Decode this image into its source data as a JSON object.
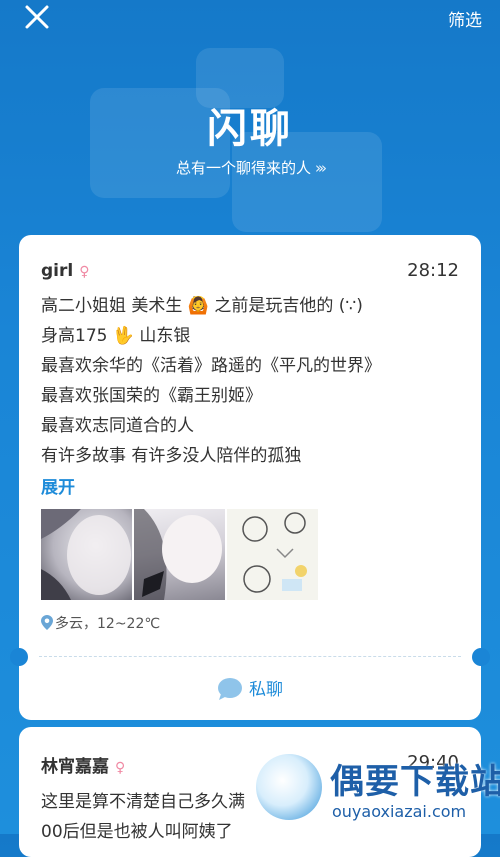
{
  "header": {
    "close_label": "✕",
    "filter_label": "筛选",
    "title": "闪聊",
    "subtitle": "总有一个聊得来的人",
    "subtitle_chevrons": "›››"
  },
  "card1": {
    "username": "girl",
    "gender_symbol": "♀",
    "time": "28:12",
    "lines": [
      "高二小姐姐 美术生 🙆 之前是玩吉他的 (∵)",
      "身高175 🖖 山东银",
      "最喜欢余华的《活着》路遥的《平凡的世界》",
      "最喜欢张国荣的《霸王别姬》",
      "最喜欢志同道合的人",
      "有许多故事 有许多没人陪伴的孤独"
    ],
    "expand_label": "展开",
    "location": "多云，12~22℃",
    "chat_label": "私聊"
  },
  "card2": {
    "username": "林宵嘉嘉",
    "gender_symbol": "♀",
    "time": "29:40",
    "line1": "这里是算不清楚自己多久满",
    "line2": "00后但是也被人叫阿姨了"
  },
  "watermark": {
    "brand": "偶要下载站",
    "url": "ouyaoxiazai.com"
  },
  "colors": {
    "background": "#1a85d6",
    "accent": "#1d8bd9",
    "gender_female": "#f08aa4"
  }
}
